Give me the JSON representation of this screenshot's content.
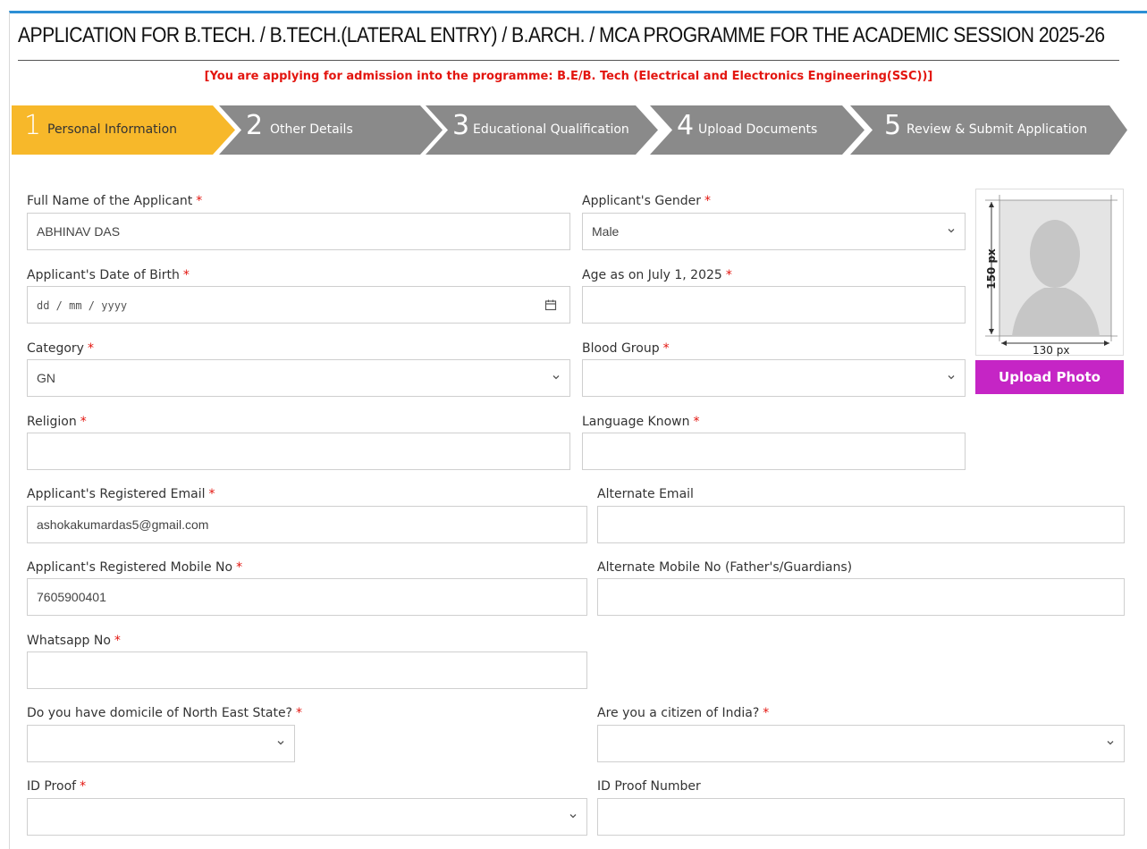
{
  "header": {
    "title": "APPLICATION FOR B.TECH. / B.TECH.(LATERAL ENTRY) / B.ARCH. / MCA PROGRAMME FOR THE ACADEMIC SESSION 2025-26",
    "programme_note": "[You are applying for admission into the programme: B.E/B. Tech (Electrical and Electronics Engineering(SSC))]"
  },
  "steps": [
    {
      "num": "1",
      "label": "Personal Information",
      "active": true
    },
    {
      "num": "2",
      "label": "Other Details",
      "active": false
    },
    {
      "num": "3",
      "label": "Educational Qualification",
      "active": false
    },
    {
      "num": "4",
      "label": "Upload Documents",
      "active": false
    },
    {
      "num": "5",
      "label": "Review & Submit Application",
      "active": false
    }
  ],
  "form": {
    "full_name": {
      "label": "Full Name of the Applicant",
      "value": "ABHINAV DAS"
    },
    "gender": {
      "label": "Applicant's Gender",
      "value": "Male"
    },
    "dob": {
      "label": "Applicant's Date of Birth",
      "placeholder": "dd / mm / yyyy"
    },
    "age": {
      "label": "Age as on July 1, 2025",
      "value": ""
    },
    "category": {
      "label": "Category",
      "value": "GN"
    },
    "blood_group": {
      "label": "Blood Group",
      "value": ""
    },
    "religion": {
      "label": "Religion",
      "value": ""
    },
    "language": {
      "label": "Language Known",
      "value": ""
    },
    "email": {
      "label": "Applicant's Registered Email",
      "value": "ashokakumardas5@gmail.com"
    },
    "alt_email": {
      "label": "Alternate Email",
      "value": ""
    },
    "mobile": {
      "label": "Applicant's Registered Mobile No",
      "value": "7605900401"
    },
    "alt_mobile": {
      "label": "Alternate Mobile No (Father's/Guardians)",
      "value": ""
    },
    "whatsapp": {
      "label": "Whatsapp No",
      "value": ""
    },
    "domicile": {
      "label": "Do you have domicile of North East State?",
      "value": ""
    },
    "citizen": {
      "label": "Are you a citizen of India?",
      "value": ""
    },
    "id_proof": {
      "label": "ID Proof",
      "value": ""
    },
    "id_proof_number": {
      "label": "ID Proof Number",
      "value": ""
    },
    "required_mark": "*"
  },
  "photo": {
    "height_label": "150 px",
    "width_label": "130 px",
    "upload_label": "Upload Photo"
  },
  "colors": {
    "accent": "#2d8fd5",
    "active_step": "#f7b82a",
    "inactive_step": "#8a8a8a",
    "required": "#e3150f",
    "upload_button": "#c525c5"
  }
}
